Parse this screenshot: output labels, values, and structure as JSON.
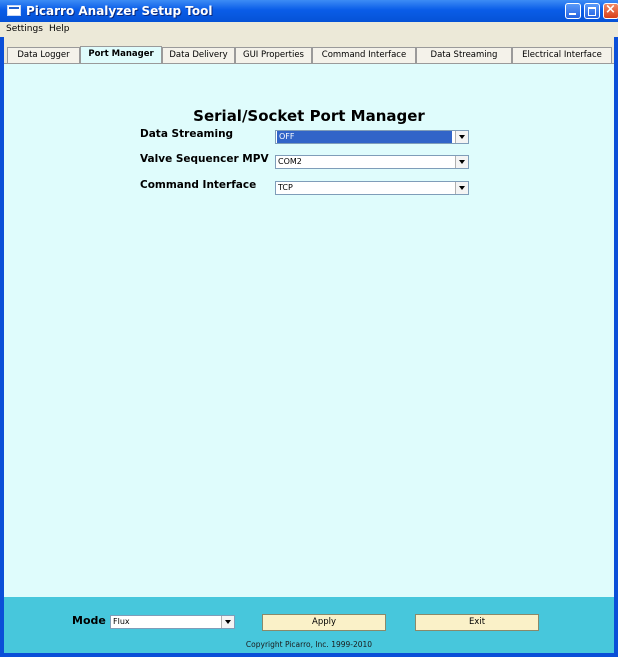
{
  "window": {
    "title": "Picarro Analyzer Setup Tool"
  },
  "menu": {
    "items": [
      "Settings",
      "Help"
    ]
  },
  "tabs": [
    {
      "label": "Data Logger",
      "active": false
    },
    {
      "label": "Port Manager",
      "active": true
    },
    {
      "label": "Data Delivery",
      "active": false
    },
    {
      "label": "GUI Properties",
      "active": false
    },
    {
      "label": "Command Interface",
      "active": false
    },
    {
      "label": "Data Streaming",
      "active": false
    },
    {
      "label": "Electrical Interface",
      "active": false
    }
  ],
  "panel": {
    "title": "Serial/Socket Port Manager",
    "rows": [
      {
        "label": "Data Streaming",
        "value": "OFF"
      },
      {
        "label": "Valve Sequencer MPV",
        "value": "COM2"
      },
      {
        "label": "Command Interface",
        "value": "TCP"
      }
    ]
  },
  "bottom": {
    "mode_label": "Mode",
    "mode_value": "Flux",
    "apply_label": "Apply",
    "exit_label": "Exit",
    "copyright": "Copyright Picarro, Inc. 1999-2010"
  },
  "colors": {
    "panel_bg": "#dffcfc",
    "bottom_bar": "#47c7dc",
    "title_bar": "#0a5de8",
    "selection": "#3164c8"
  }
}
